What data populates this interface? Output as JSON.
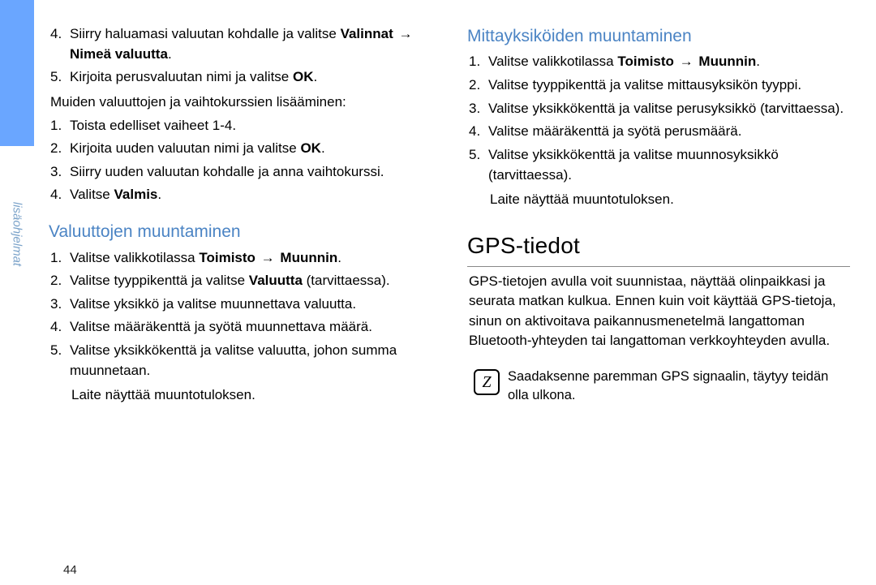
{
  "sidebar": {
    "label": "lisäohjelmat"
  },
  "left": {
    "listA": [
      {
        "n": "4.",
        "pre": "Siirry haluamasi valuutan kohdalle ja valitse ",
        "bold1": "Valinnat",
        "arrow": "→",
        "bold2": "Nimeä valuutta",
        "post": "."
      },
      {
        "n": "5.",
        "pre": "Kirjoita perusvaluutan nimi ja valitse ",
        "bold1": "OK",
        "post": "."
      }
    ],
    "intro": "Muiden valuuttojen ja vaihtokurssien lisääminen:",
    "listB": [
      {
        "n": "1.",
        "text": "Toista edelliset vaiheet 1-4."
      },
      {
        "n": "2.",
        "pre": "Kirjoita uuden valuutan nimi ja valitse ",
        "bold1": "OK",
        "post": "."
      },
      {
        "n": "3.",
        "text": "Siirry uuden valuutan kohdalle ja anna vaihtokurssi."
      },
      {
        "n": "4.",
        "pre": "Valitse ",
        "bold1": "Valmis",
        "post": "."
      }
    ],
    "h1": "Valuuttojen muuntaminen",
    "listC": [
      {
        "n": "1.",
        "pre": "Valitse valikkotilassa ",
        "bold1": "Toimisto",
        "arrow": "→",
        "bold2": "Muunnin",
        "post": "."
      },
      {
        "n": "2.",
        "pre": "Valitse tyyppikenttä ja valitse ",
        "bold1": "Valuutta",
        "post": " (tarvittaessa)."
      },
      {
        "n": "3.",
        "text": "Valitse yksikkö ja valitse muunnettava valuutta."
      },
      {
        "n": "4.",
        "text": "Valitse määräkenttä ja syötä muunnettava määrä."
      },
      {
        "n": "5.",
        "text": "Valitse yksikkökenttä ja valitse valuutta, johon summa muunnetaan."
      }
    ],
    "tail": "Laite näyttää muuntotuloksen."
  },
  "right": {
    "h1": "Mittayksiköiden muuntaminen",
    "listA": [
      {
        "n": "1.",
        "pre": "Valitse valikkotilassa ",
        "bold1": "Toimisto",
        "arrow": "→",
        "bold2": "Muunnin",
        "post": "."
      },
      {
        "n": "2.",
        "text": "Valitse tyyppikenttä ja valitse mittausyksikön tyyppi."
      },
      {
        "n": "3.",
        "text": "Valitse yksikkökenttä ja valitse perusyksikkö (tarvittaessa)."
      },
      {
        "n": "4.",
        "text": "Valitse määräkenttä ja syötä perusmäärä."
      },
      {
        "n": "5.",
        "text": "Valitse yksikkökenttä ja valitse muunnosyksikkö (tarvittaessa)."
      }
    ],
    "tail": "Laite näyttää muuntotuloksen.",
    "h2": "GPS-tiedot",
    "body": "GPS-tietojen avulla voit suunnistaa, näyttää olinpaikkasi ja seurata matkan kulkua. Ennen kuin voit käyttää GPS-tietoja, sinun on aktivoitava paikannusmenetelmä langattoman Bluetooth-yhteyden tai langattoman verkkoyhteyden avulla.",
    "note_icon": "Z",
    "note": "Saadaksenne paremman GPS signaalin, täytyy teidän olla ulkona."
  },
  "page_number": "44"
}
